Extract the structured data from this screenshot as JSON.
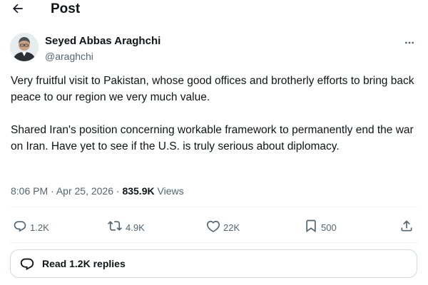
{
  "header": {
    "title": "Post",
    "back_icon": "arrow-left-icon"
  },
  "author": {
    "name": "Seyed Abbas Araghchi",
    "handle": "@araghchi",
    "avatar_icon": "user-avatar",
    "more_icon": "more-horizontal-icon"
  },
  "post": {
    "paragraphs": [
      "Very fruitful visit to Pakistan, whose good offices and brotherly efforts to bring back peace to our region we very much value.",
      "Shared Iran's position concerning workable framework to permanently end the war on Iran. Have yet to see if the U.S. is truly serious about diplomacy."
    ]
  },
  "meta": {
    "time": "8:06 PM",
    "separator": "·",
    "date": "Apr 25, 2026",
    "views_count": "835.9K",
    "views_label": "Views"
  },
  "actions": {
    "reply": {
      "icon": "reply-icon",
      "count": "1.2K"
    },
    "repost": {
      "icon": "repost-icon",
      "count": "4.9K"
    },
    "like": {
      "icon": "heart-icon",
      "count": "22K"
    },
    "bookmark": {
      "icon": "bookmark-icon",
      "count": "500"
    },
    "share": {
      "icon": "share-icon"
    }
  },
  "replies": {
    "icon": "reply-bubble-icon",
    "label": "Read 1.2K replies"
  },
  "colors": {
    "text": "#0f1419",
    "secondary": "#536471",
    "border": "#cfd9de",
    "divider": "#eff3f4"
  }
}
